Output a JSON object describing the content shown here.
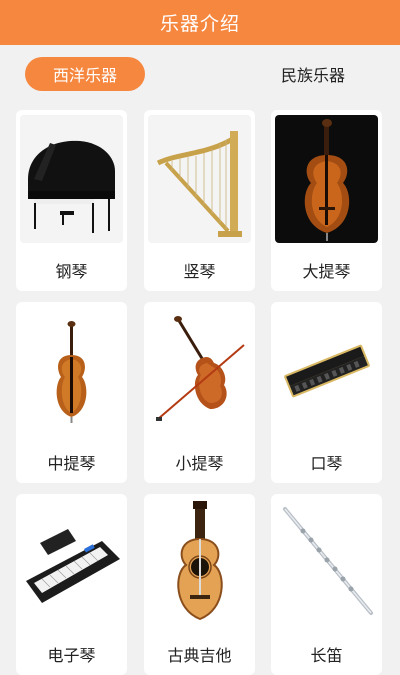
{
  "header": {
    "title": "乐器介绍"
  },
  "tabs": [
    {
      "label": "西洋乐器",
      "active": true
    },
    {
      "label": "民族乐器",
      "active": false
    }
  ],
  "instruments": [
    {
      "name": "钢琴",
      "icon": "piano-icon"
    },
    {
      "name": "竖琴",
      "icon": "harp-icon"
    },
    {
      "name": "大提琴",
      "icon": "cello-icon"
    },
    {
      "name": "中提琴",
      "icon": "viola-icon"
    },
    {
      "name": "小提琴",
      "icon": "violin-icon"
    },
    {
      "name": "口琴",
      "icon": "harmonica-icon"
    },
    {
      "name": "电子琴",
      "icon": "keyboard-icon"
    },
    {
      "name": "古典吉他",
      "icon": "guitar-icon"
    },
    {
      "name": "长笛",
      "icon": "flute-icon"
    }
  ],
  "colors": {
    "accent": "#f6873f",
    "background": "#f1f1f1",
    "card": "#ffffff"
  }
}
